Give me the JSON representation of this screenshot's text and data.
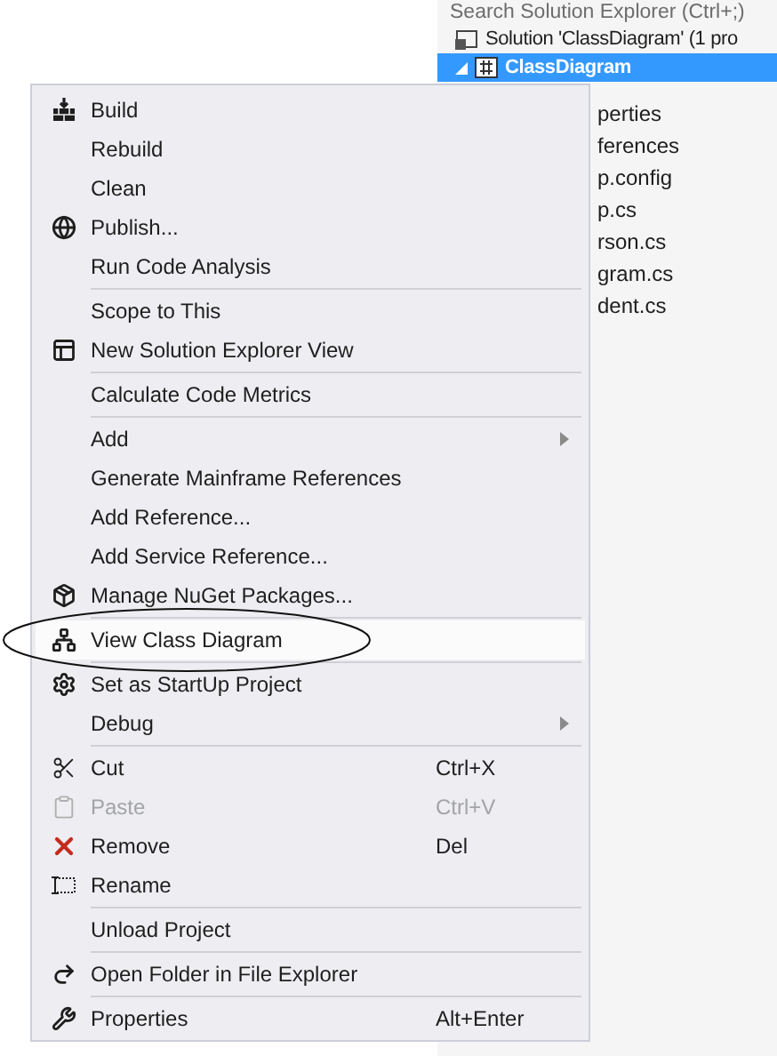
{
  "solution_explorer": {
    "search": {
      "placeholder": "Search Solution Explorer (Ctrl+;)"
    },
    "solution_row": {
      "label": "Solution 'ClassDiagram' (1 pro"
    },
    "project_row": {
      "label": "ClassDiagram",
      "selected": true,
      "expanded": true
    },
    "items": [
      {
        "label": "perties"
      },
      {
        "label": "ferences"
      },
      {
        "label": "p.config"
      },
      {
        "label": "p.cs"
      },
      {
        "label": "rson.cs"
      },
      {
        "label": "gram.cs"
      },
      {
        "label": "dent.cs"
      }
    ]
  },
  "context_menu": {
    "groups": [
      [
        {
          "label": "Build",
          "selected": false,
          "disabled": false,
          "submenu": false
        },
        {
          "label": "Rebuild",
          "selected": false,
          "disabled": false,
          "submenu": false
        },
        {
          "label": "Clean",
          "selected": false,
          "disabled": false,
          "submenu": false
        },
        {
          "label": "Publish...",
          "selected": false,
          "disabled": false,
          "submenu": false
        },
        {
          "label": "Run Code Analysis",
          "selected": false,
          "disabled": false,
          "submenu": false
        }
      ],
      [
        {
          "label": "Scope to This",
          "selected": false,
          "disabled": false,
          "submenu": false
        },
        {
          "label": "New Solution Explorer View",
          "selected": false,
          "disabled": false,
          "submenu": false
        }
      ],
      [
        {
          "label": "Calculate Code Metrics",
          "selected": false,
          "disabled": false,
          "submenu": false
        }
      ],
      [
        {
          "label": "Add",
          "selected": false,
          "disabled": false,
          "submenu": true
        },
        {
          "label": "Generate Mainframe References",
          "selected": false,
          "disabled": false,
          "submenu": false
        },
        {
          "label": "Add Reference...",
          "selected": false,
          "disabled": false,
          "submenu": false
        },
        {
          "label": "Add Service Reference...",
          "selected": false,
          "disabled": false,
          "submenu": false
        },
        {
          "label": "Manage NuGet Packages...",
          "selected": false,
          "disabled": false,
          "submenu": false
        }
      ],
      [
        {
          "label": "View Class Diagram",
          "selected": true,
          "disabled": false,
          "submenu": false
        }
      ],
      [
        {
          "label": "Set as StartUp Project",
          "selected": false,
          "disabled": false,
          "submenu": false
        },
        {
          "label": "Debug",
          "selected": false,
          "disabled": false,
          "submenu": true
        }
      ],
      [
        {
          "label": "Cut",
          "shortcut": "Ctrl+X",
          "selected": false,
          "disabled": false,
          "submenu": false
        },
        {
          "label": "Paste",
          "shortcut": "Ctrl+V",
          "selected": false,
          "disabled": true,
          "submenu": false
        },
        {
          "label": "Remove",
          "shortcut": "Del",
          "selected": false,
          "disabled": false,
          "submenu": false
        },
        {
          "label": "Rename",
          "selected": false,
          "disabled": false,
          "submenu": false
        }
      ],
      [
        {
          "label": "Unload Project",
          "selected": false,
          "disabled": false,
          "submenu": false
        }
      ],
      [
        {
          "label": "Open Folder in File Explorer",
          "selected": false,
          "disabled": false,
          "submenu": false
        }
      ],
      [
        {
          "label": "Properties",
          "shortcut": "Alt+Enter",
          "selected": false,
          "disabled": false,
          "submenu": false
        }
      ]
    ]
  }
}
